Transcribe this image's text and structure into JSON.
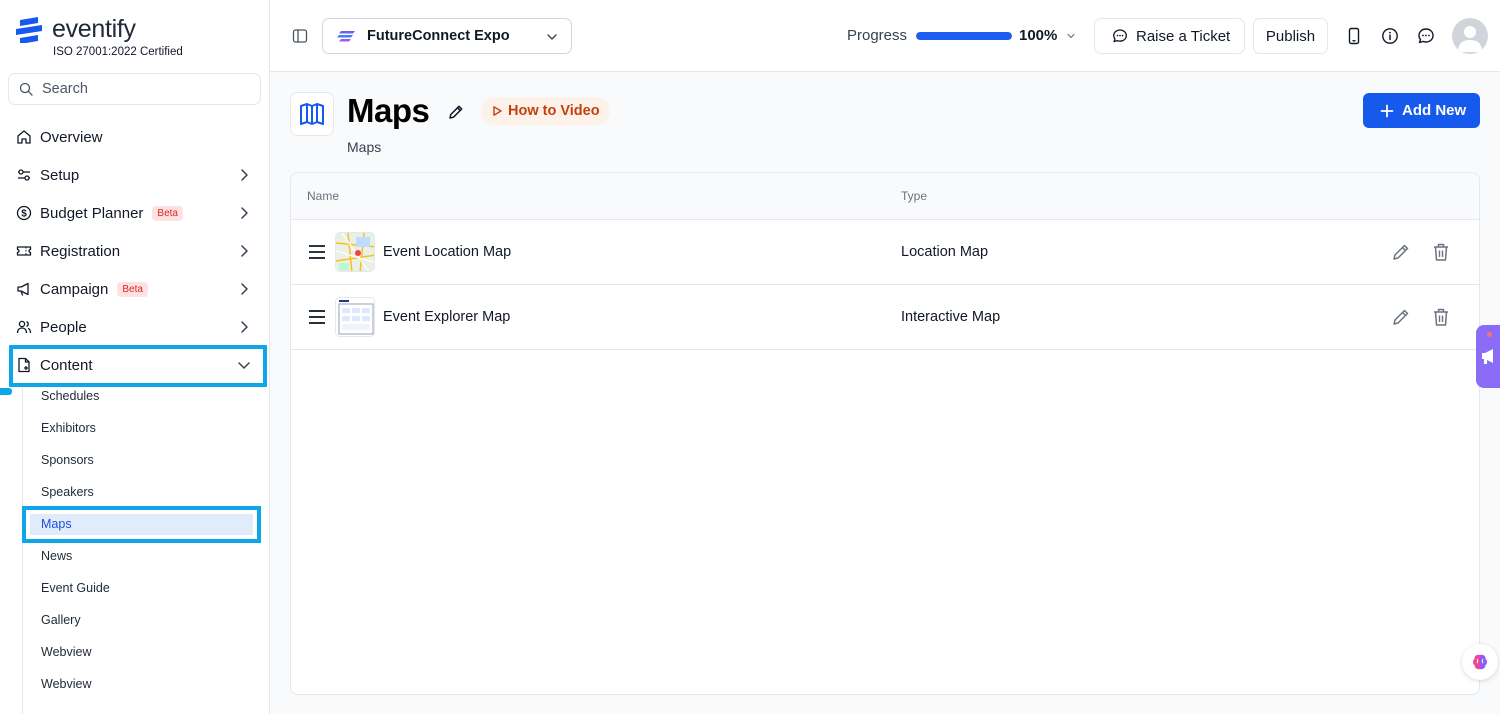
{
  "brand": {
    "name": "eventify",
    "certification": "ISO 27001:2022 Certified",
    "color": "#1559ed"
  },
  "search": {
    "placeholder": "Search",
    "value": ""
  },
  "sidebar": {
    "items": [
      {
        "label": "Overview",
        "icon": "home-icon"
      },
      {
        "label": "Setup",
        "icon": "sliders-icon"
      },
      {
        "label": "Budget Planner",
        "icon": "dollar-circle-icon",
        "badge": "Beta"
      },
      {
        "label": "Registration",
        "icon": "ticket-icon"
      },
      {
        "label": "Campaign",
        "icon": "megaphone-icon",
        "badge": "Beta"
      },
      {
        "label": "People",
        "icon": "users-icon"
      },
      {
        "label": "Content",
        "icon": "document-icon",
        "expanded": true
      }
    ],
    "content_subitems": [
      "Schedules",
      "Exhibitors",
      "Sponsors",
      "Speakers",
      "Maps",
      "News",
      "Event Guide",
      "Gallery",
      "Webview",
      "Webview"
    ],
    "active_subitem": "Maps"
  },
  "topbar": {
    "event_name": "FutureConnect Expo",
    "progress_label": "Progress",
    "progress_value": "100%",
    "progress_fraction": 1.0,
    "ticket_label": "Raise a Ticket",
    "publish_label": "Publish"
  },
  "page": {
    "title": "Maps",
    "subtitle": "Maps",
    "video_label": "How to Video",
    "add_label": "Add New"
  },
  "table": {
    "columns": [
      "Name",
      "Type"
    ],
    "rows": [
      {
        "name": "Event Location Map",
        "type": "Location Map"
      },
      {
        "name": "Event Explorer Map",
        "type": "Interactive Map"
      }
    ]
  },
  "colors": {
    "highlight": "#0ea5e9",
    "beta": "#dc2626",
    "video": "#c2410c",
    "widget": "#8b6cf6"
  }
}
